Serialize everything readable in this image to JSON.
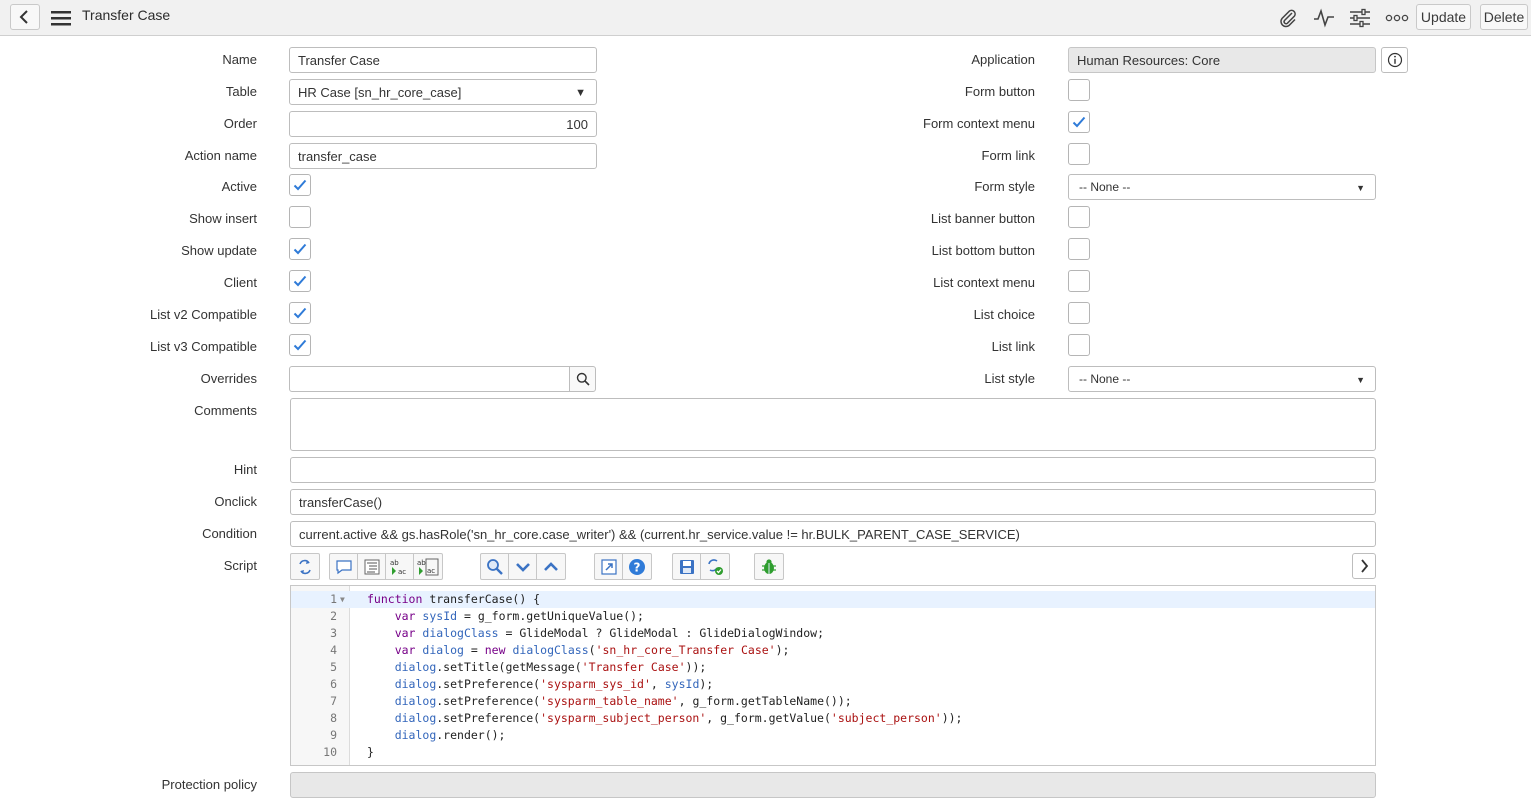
{
  "header": {
    "title": "Transfer Case",
    "update_label": "Update",
    "delete_label": "Delete"
  },
  "left_fields": {
    "name": {
      "label": "Name",
      "value": "Transfer Case"
    },
    "table": {
      "label": "Table",
      "value": "HR Case [sn_hr_core_case]"
    },
    "order": {
      "label": "Order",
      "value": "100"
    },
    "action_name": {
      "label": "Action name",
      "value": "transfer_case"
    },
    "active": {
      "label": "Active",
      "checked": true
    },
    "show_insert": {
      "label": "Show insert",
      "checked": false
    },
    "show_update": {
      "label": "Show update",
      "checked": true
    },
    "client": {
      "label": "Client",
      "checked": true
    },
    "list_v2": {
      "label": "List v2 Compatible",
      "checked": true
    },
    "list_v3": {
      "label": "List v3 Compatible",
      "checked": true
    },
    "overrides": {
      "label": "Overrides",
      "value": ""
    }
  },
  "right_fields": {
    "application": {
      "label": "Application",
      "value": "Human Resources: Core"
    },
    "form_button": {
      "label": "Form button",
      "checked": false
    },
    "form_context_menu": {
      "label": "Form context menu",
      "checked": true
    },
    "form_link": {
      "label": "Form link",
      "checked": false
    },
    "form_style": {
      "label": "Form style",
      "value": "-- None --"
    },
    "list_banner_button": {
      "label": "List banner button",
      "checked": false
    },
    "list_bottom_button": {
      "label": "List bottom button",
      "checked": false
    },
    "list_context_menu": {
      "label": "List context menu",
      "checked": false
    },
    "list_choice": {
      "label": "List choice",
      "checked": false
    },
    "list_link": {
      "label": "List link",
      "checked": false
    },
    "list_style": {
      "label": "List style",
      "value": "-- None --"
    }
  },
  "wide_fields": {
    "comments": {
      "label": "Comments",
      "value": ""
    },
    "hint": {
      "label": "Hint",
      "value": ""
    },
    "onclick": {
      "label": "Onclick",
      "value": "transferCase()"
    },
    "condition": {
      "label": "Condition",
      "value": "current.active && gs.hasRole('sn_hr_core.case_writer') && (current.hr_service.value != hr.BULK_PARENT_CASE_SERVICE)"
    },
    "script": {
      "label": "Script"
    },
    "protection_policy": {
      "label": "Protection policy",
      "value": ""
    }
  },
  "script_lines": [
    {
      "n": "1",
      "text": "function transferCase() {"
    },
    {
      "n": "2",
      "text": "    var sysId = g_form.getUniqueValue();"
    },
    {
      "n": "3",
      "text": "    var dialogClass = GlideModal ? GlideModal : GlideDialogWindow;"
    },
    {
      "n": "4",
      "text": "    var dialog = new dialogClass('sn_hr_core_Transfer Case');"
    },
    {
      "n": "5",
      "text": "    dialog.setTitle(getMessage('Transfer Case'));"
    },
    {
      "n": "6",
      "text": "    dialog.setPreference('sysparm_sys_id', sysId);"
    },
    {
      "n": "7",
      "text": "    dialog.setPreference('sysparm_table_name', g_form.getTableName());"
    },
    {
      "n": "8",
      "text": "    dialog.setPreference('sysparm_subject_person', g_form.getValue('subject_person'));"
    },
    {
      "n": "9",
      "text": "    dialog.render();"
    },
    {
      "n": "10",
      "text": "}"
    }
  ],
  "colors": {
    "accent": "#2f7bd8",
    "keyword": "#770088",
    "variable": "#3366bb",
    "string": "#aa1111"
  }
}
